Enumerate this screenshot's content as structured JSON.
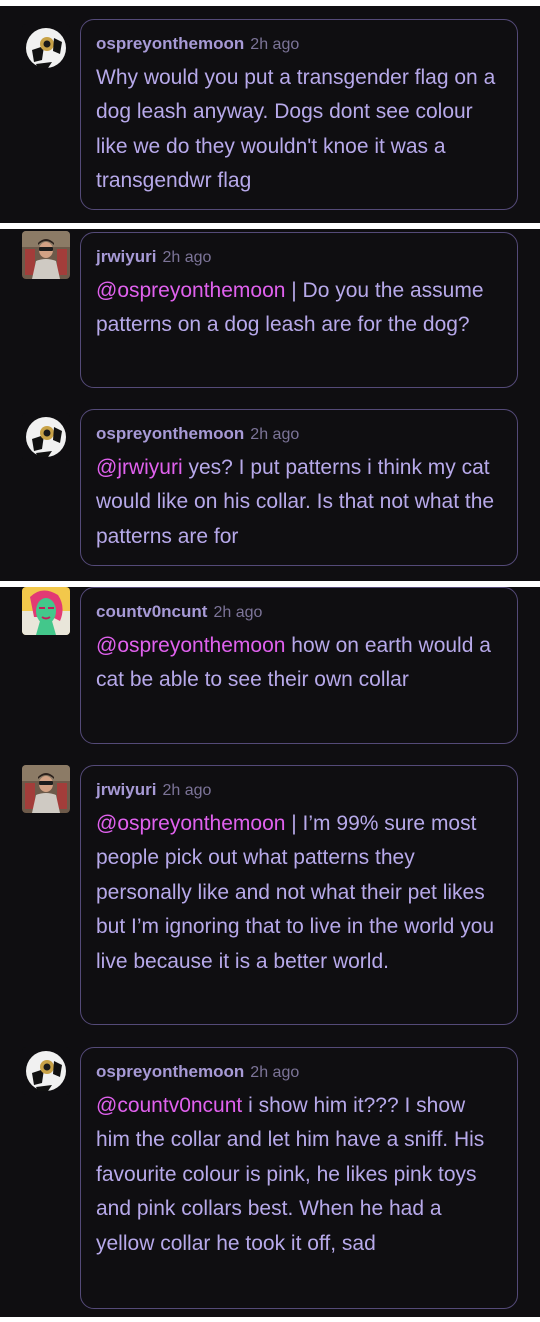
{
  "time_label": "2h ago",
  "colors": {
    "background": "#0f0e11",
    "border": "#544a78",
    "username": "#a79ad6",
    "body_text": "#b7a9ea",
    "mention": "#e061ee"
  },
  "avatars": {
    "ospreyonthemoon": "mask-avatar",
    "jrwiyuri": "photo-avatar",
    "countv0ncunt": "pink-face-avatar"
  },
  "comments": [
    {
      "user": "ospreyonthemoon",
      "time": "2h ago",
      "mention": "",
      "text": "Why would you put a transgender flag on a dog leash anyway. Dogs dont see colour like we do they wouldn't knoe it was a transgendwr flag"
    },
    {
      "user": "jrwiyuri",
      "time": "2h ago",
      "mention": "@ospreyonthemoon",
      "text": " | Do you the assume patterns on a dog leash are for the dog?"
    },
    {
      "user": "ospreyonthemoon",
      "time": "2h ago",
      "mention": "@jrwiyuri",
      "text": " yes? I put patterns i think my cat would like on his collar. Is that not what the patterns are for"
    },
    {
      "user": "countv0ncunt",
      "time": "2h ago",
      "mention": "@ospreyonthemoon",
      "text": " how on earth would a cat be able to see their own collar"
    },
    {
      "user": "jrwiyuri",
      "time": "2h ago",
      "mention": "@ospreyonthemoon",
      "text": " | I’m 99% sure most people pick out what patterns they personally like and not what their pet likes but I’m ignoring that to live in the world you live because it is a better world."
    },
    {
      "user": "ospreyonthemoon",
      "time": "2h ago",
      "mention": "@countv0ncunt",
      "text": " i show him it??? I show him the collar and let him have a sniff. His favourite colour is pink, he likes pink toys and pink collars best. When he had a yellow collar he took it off, sad"
    }
  ]
}
